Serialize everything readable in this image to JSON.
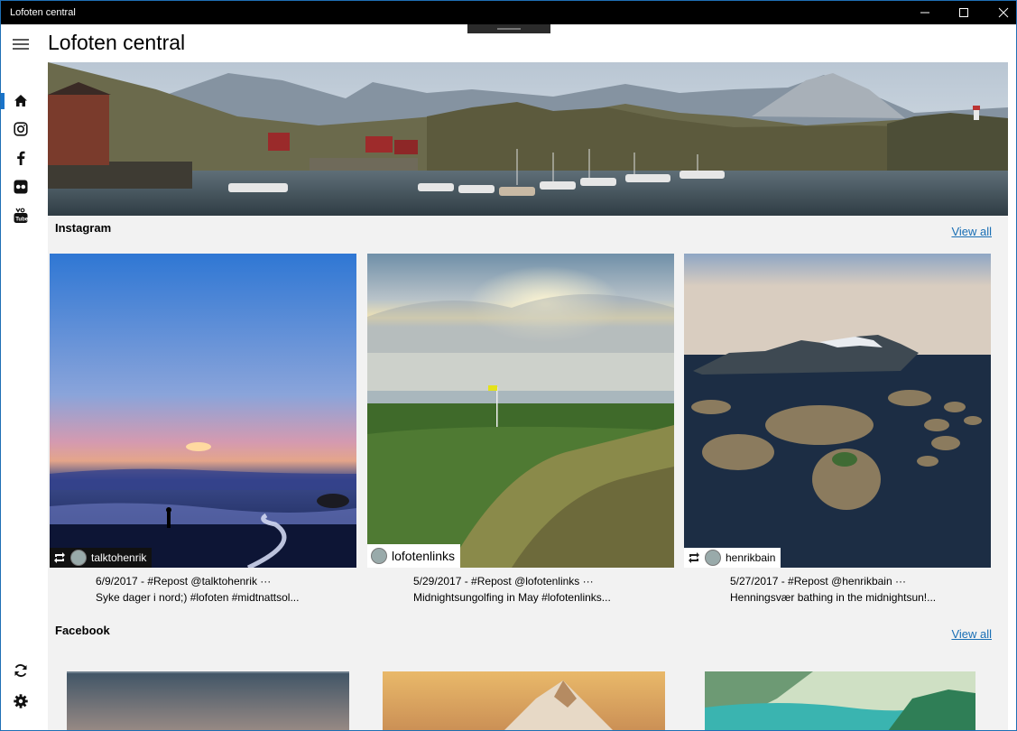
{
  "window": {
    "title": "Lofoten central"
  },
  "app": {
    "title": "Lofoten central"
  },
  "sidebar": {
    "items": [
      {
        "name": "home-icon",
        "label": "Home"
      },
      {
        "name": "instagram-icon",
        "label": "Instagram"
      },
      {
        "name": "facebook-icon",
        "label": "Facebook"
      },
      {
        "name": "flickr-icon",
        "label": "Flickr"
      },
      {
        "name": "youtube-icon",
        "label": "YouTube"
      }
    ],
    "bottom": [
      {
        "name": "refresh-icon"
      },
      {
        "name": "settings-icon"
      }
    ]
  },
  "instagram": {
    "title": "Instagram",
    "view_all": "View all",
    "posts": [
      {
        "user": "talktohenrik",
        "date_text": "6/9/2017 - #Repost @talktohenrik",
        "caption": "Syke dager i nord;) #lofoten #midtnattsol..."
      },
      {
        "user": "lofotenlinks",
        "date_text": "5/29/2017 - #Repost @lofotenlinks",
        "caption": "Midnightsungolfing in May #lofotenlinks..."
      },
      {
        "user": "henrikbain",
        "date_text": "5/27/2017 - #Repost @henrikbain",
        "caption": "Henningsvær bathing in the midnightsun!..."
      }
    ]
  },
  "facebook": {
    "title": "Facebook",
    "view_all": "View all"
  },
  "colors": {
    "accent": "#1a73c9",
    "link": "#1a6fb5",
    "titlebar": "#000000"
  }
}
